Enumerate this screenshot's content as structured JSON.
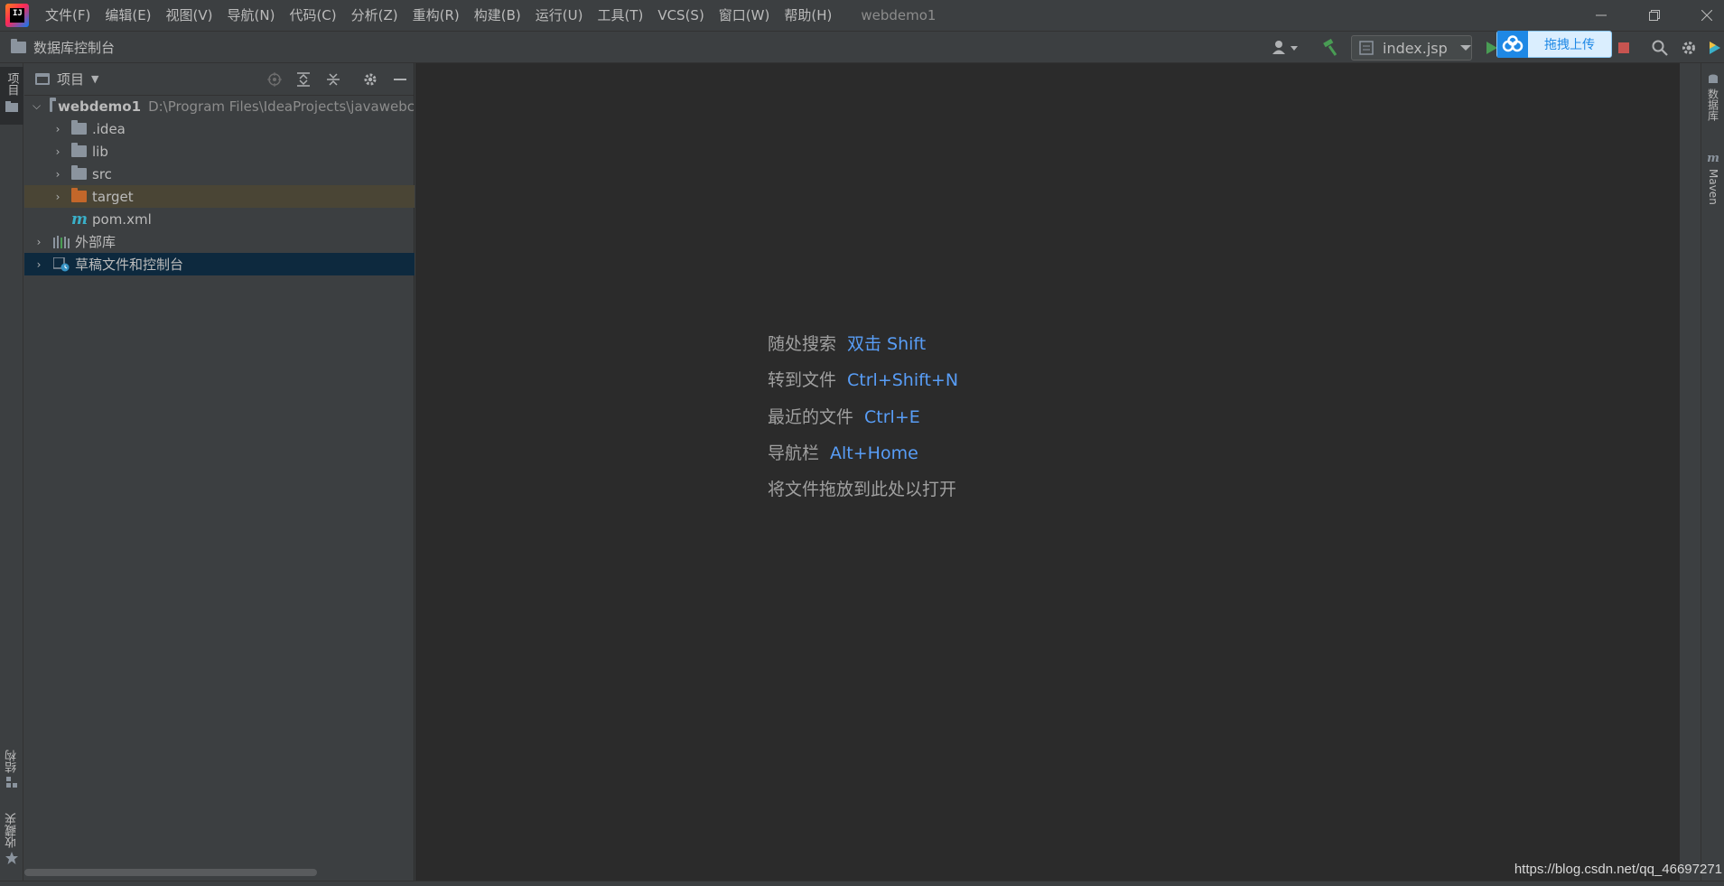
{
  "app": {
    "logo_text": "IJ",
    "window_title": "webdemo1"
  },
  "menu": [
    "文件(F)",
    "编辑(E)",
    "视图(V)",
    "导航(N)",
    "代码(C)",
    "分析(Z)",
    "重构(R)",
    "构建(B)",
    "运行(U)",
    "工具(T)",
    "VCS(S)",
    "窗口(W)",
    "帮助(H)"
  ],
  "nav": {
    "crumb": "数据库控制台"
  },
  "toolbar": {
    "run_config": "index.jsp",
    "upload_label": "拖拽上传"
  },
  "left_stripe": {
    "project_tab": "项目",
    "structure_tab": "结构",
    "favorites_tab": "收藏夹"
  },
  "right_stripe": {
    "database_tab": "数据库",
    "maven_tab": "Maven"
  },
  "project_panel": {
    "title": "项目",
    "tree": [
      {
        "label": "webdemo1",
        "path": "D:\\Program Files\\IdeaProjects\\javawebc"
      },
      {
        "label": ".idea"
      },
      {
        "label": "lib"
      },
      {
        "label": "src"
      },
      {
        "label": "target"
      },
      {
        "label": "pom.xml"
      },
      {
        "label": "外部库"
      },
      {
        "label": "草稿文件和控制台"
      }
    ]
  },
  "editor": {
    "hints": [
      {
        "text": "随处搜索",
        "key": "双击 Shift"
      },
      {
        "text": "转到文件",
        "key": "Ctrl+Shift+N"
      },
      {
        "text": "最近的文件",
        "key": "Ctrl+E"
      },
      {
        "text": "导航栏",
        "key": "Alt+Home"
      },
      {
        "text": "将文件拖放到此处以打开",
        "key": ""
      }
    ]
  },
  "watermark": "https://blog.csdn.net/qq_46697271",
  "colors": {
    "accent": "#589df6",
    "target_folder": "#c3672a",
    "selected_row": "#0d293e",
    "highlight_row": "#4a4535"
  }
}
